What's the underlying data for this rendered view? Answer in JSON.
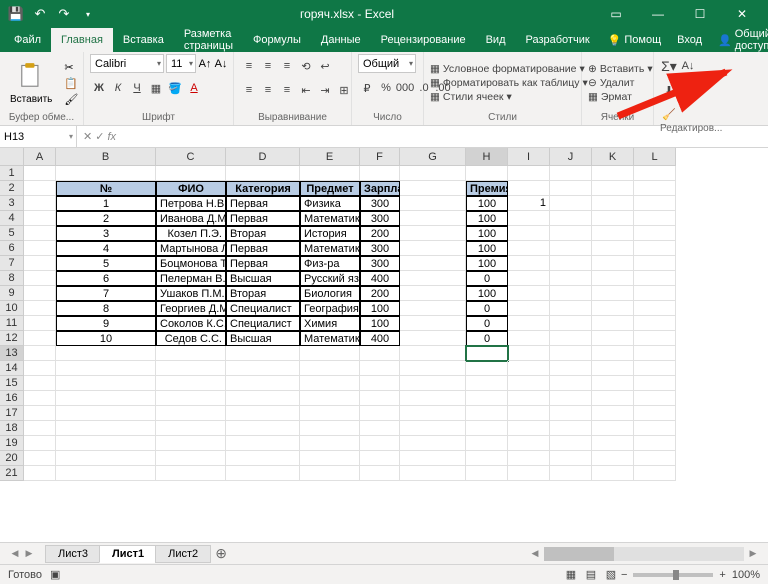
{
  "titlebar": {
    "title": "горяч.xlsx - Excel"
  },
  "tabs": [
    "Файл",
    "Главная",
    "Вставка",
    "Разметка страницы",
    "Формулы",
    "Данные",
    "Рецензирование",
    "Вид",
    "Разработчик"
  ],
  "righttabs": {
    "help": "Помощ",
    "signin": "Вход",
    "share": "Общий доступ"
  },
  "ribbon": {
    "paste": "Вставить",
    "clipboard_label": "Буфер обме...",
    "font_name": "Calibri",
    "font_size": "11",
    "font_label": "Шрифт",
    "align_label": "Выравнивание",
    "number_format": "Общий",
    "number_label": "Число",
    "cond_fmt": "Условное форматирование",
    "fmt_table": "Форматировать как таблицу",
    "cell_styles": "Стили ячеек",
    "styles_label": "Стили",
    "insert": "Вставить",
    "delete": "Удалит",
    "format": "Эрмат",
    "cells_label": "Ячейки",
    "edit_label": "Редактиров..."
  },
  "namebox": "H13",
  "columns": [
    "A",
    "B",
    "C",
    "D",
    "E",
    "F",
    "G",
    "H",
    "I",
    "J",
    "K",
    "L"
  ],
  "rownums": [
    1,
    2,
    3,
    4,
    5,
    6,
    7,
    8,
    9,
    10,
    11,
    12,
    13,
    14,
    15,
    16,
    17,
    18,
    19,
    20,
    21
  ],
  "headers": {
    "num": "№",
    "fio": "ФИО",
    "cat": "Категория",
    "subj": "Предмет",
    "sal": "Зарплата",
    "bonus": "Премия"
  },
  "rows": [
    {
      "n": "1",
      "fio": "Петрова Н.В.",
      "cat": "Первая",
      "subj": "Физика",
      "sal": "300",
      "bonus": "100"
    },
    {
      "n": "2",
      "fio": "Иванова Д.М.",
      "cat": "Первая",
      "subj": "Математика",
      "sal": "300",
      "bonus": "100"
    },
    {
      "n": "3",
      "fio": "Козел П.Э.",
      "cat": "Вторая",
      "subj": "История",
      "sal": "200",
      "bonus": "100"
    },
    {
      "n": "4",
      "fio": "Мартынова Л.П.",
      "cat": "Первая",
      "subj": "Математика",
      "sal": "300",
      "bonus": "100"
    },
    {
      "n": "5",
      "fio": "Боцмонова Т.А.",
      "cat": "Первая",
      "subj": "Физ-ра",
      "sal": "300",
      "bonus": "100"
    },
    {
      "n": "6",
      "fio": "Пелерман В.И.",
      "cat": "Высшая",
      "subj": "Русский язык",
      "sal": "400",
      "bonus": "0"
    },
    {
      "n": "7",
      "fio": "Ушаков П.М.",
      "cat": "Вторая",
      "subj": "Биология",
      "sal": "200",
      "bonus": "100"
    },
    {
      "n": "8",
      "fio": "Георгиев Д.М.",
      "cat": "Специалист",
      "subj": "География",
      "sal": "100",
      "bonus": "0"
    },
    {
      "n": "9",
      "fio": "Соколов К.С.",
      "cat": "Специалист",
      "subj": "Химия",
      "sal": "100",
      "bonus": "0"
    },
    {
      "n": "10",
      "fio": "Седов С.С.",
      "cat": "Высшая",
      "subj": "Математика",
      "sal": "400",
      "bonus": "0"
    }
  ],
  "i3": "1",
  "sheets": [
    "Лист3",
    "Лист1",
    "Лист2"
  ],
  "active_sheet": 1,
  "status": {
    "ready": "Готово",
    "zoom": "100%"
  }
}
